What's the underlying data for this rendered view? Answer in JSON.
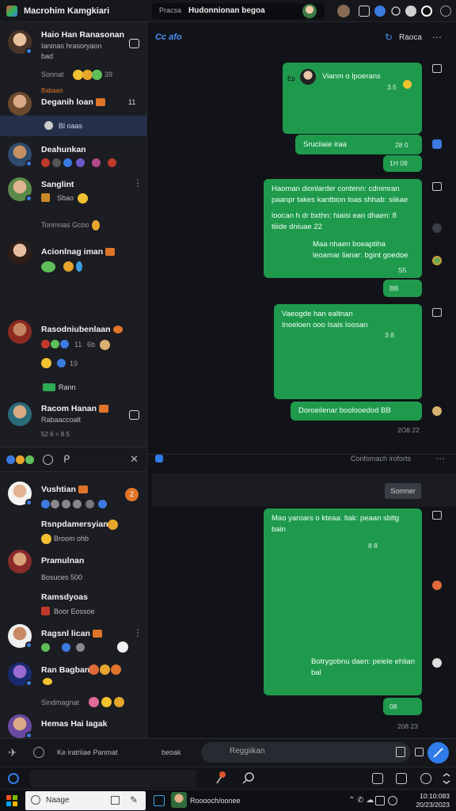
{
  "window": {
    "app_title": "Macrohim Kamgkiari",
    "search_prefix": "Pracsa",
    "search_title": "Hudonnionan begoa"
  },
  "sidebar": {
    "chats": [
      {
        "name": "Haio Han Ranasonan",
        "sub1": "Ianinas hrasoryaon",
        "sub2": "bad"
      },
      {
        "status": "Sonnat",
        "count": "39",
        "label": "Babaan"
      },
      {
        "name": "Deganih loan",
        "count": "11",
        "sel_label": "Bl oaas"
      },
      {
        "name": "Deahunkan"
      },
      {
        "name": "Sanglint",
        "sub": "Sbao"
      },
      {
        "status": "Tonmnas Gcoo"
      },
      {
        "name": "Acionlnag iman"
      },
      {
        "name": "Rasodniubenlaan",
        "count1": "11",
        "count2": "6b",
        "count3": "19"
      },
      {
        "label": "Rann"
      },
      {
        "name": "Racom Hanan",
        "sub": "Rabaaccoalt",
        "stat": "52 6 > 8 5"
      }
    ],
    "chats2": [
      {
        "name": "Vushtian"
      },
      {
        "name": "Rsnpdamersyian",
        "sub": "Broom ohb"
      },
      {
        "name": "Pramulnan",
        "sub": "Bosuces 500"
      },
      {
        "name": "Ramsdyoas",
        "sub": "Boor Eossoe"
      },
      {
        "name": "Ragsnl lican"
      },
      {
        "name": "Ran Bagban"
      },
      {
        "status": "Sindmagnat"
      },
      {
        "name": "Hemas Hai Iagak"
      }
    ],
    "notif_badge": "2"
  },
  "main": {
    "header_link": "Cc afo",
    "header_right": "Raoca",
    "messages": [
      {
        "text": "Vianm o lpoerans",
        "time": "3.5",
        "label": "Ep"
      },
      {
        "text": "Sruciiaie iraa",
        "time": "28 0"
      },
      {
        "text": "",
        "time": "1H 08"
      },
      {
        "line1": "Haoman dionlarder contenn: cdnimran",
        "line2": "paanpr takes kantbion toas shhab: siikae",
        "line3": "loocan h dr bxthn: hiaisi ean dhaen: 8",
        "line4": "tiiide dniuae 22",
        "line5": "Maa nhaen boeaptiha",
        "line6": "leoamar lianar: bgint goedoe",
        "time": "S5"
      },
      {
        "text": "",
        "time": "BB"
      },
      {
        "line1": "Vaeogde han ealtnan",
        "line2": "Inoeloen ooo Isais Ioosan",
        "time": "3 8"
      },
      {
        "text": "Doroeilenar boolooedod BB",
        "time": ""
      },
      {
        "line1": "Mao yaroars o kteaa: ltak: peaan sbltg",
        "line2": "bain",
        "time": "8 8"
      },
      {
        "line1": "Botrygobnu daen: peiele ehlian",
        "line2": "bal",
        "time": ""
      },
      {
        "text": "",
        "time": "08"
      }
    ],
    "stamp1": "2O8 22",
    "stamp2": "208 23",
    "divider_label": "Confomach iroforts",
    "banner_button": "Somner"
  },
  "composer": {
    "left_text": "Ke iratriiae Panmat",
    "left_text2": "beoak",
    "placeholder": "Reggiikan"
  },
  "taskbar": {
    "search": "Naage",
    "task_label": "Rooooch/oonee",
    "clock1": "10:10:083",
    "clock2": "20/23/2023"
  }
}
